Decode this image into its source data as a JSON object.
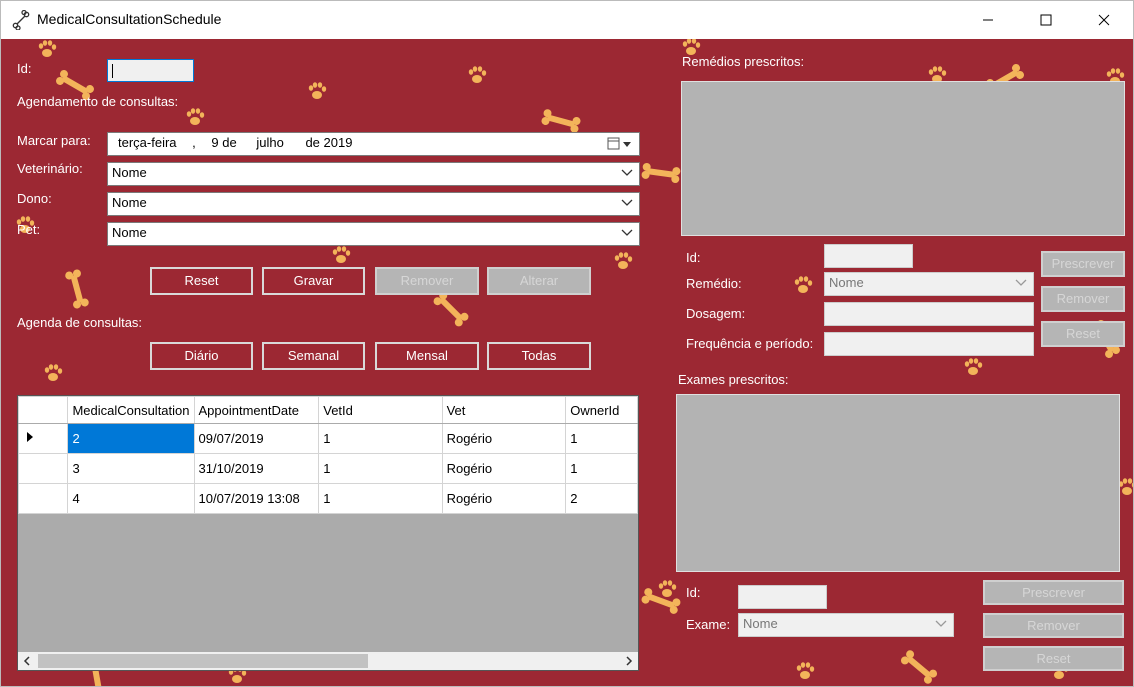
{
  "window": {
    "title": "MedicalConsultationSchedule"
  },
  "form": {
    "id_label": "Id:",
    "id_value": "",
    "agendamento_label": "Agendamento de consultas:",
    "marcar_label": "Marcar para:",
    "date": {
      "weekday": "terça-feira",
      "sep": ",",
      "day": "9 de",
      "month": "julho",
      "year": "de 2019"
    },
    "vet_label": "Veterinário:",
    "vet_value": "Nome",
    "dono_label": "Dono:",
    "dono_value": "Nome",
    "pet_label": "Pet:",
    "pet_value": "Nome",
    "buttons": {
      "reset": "Reset",
      "gravar": "Gravar",
      "remover": "Remover",
      "alterar": "Alterar"
    },
    "agenda_label": "Agenda de consultas:",
    "agenda_buttons": {
      "diario": "Diário",
      "semanal": "Semanal",
      "mensal": "Mensal",
      "todas": "Todas"
    }
  },
  "grid": {
    "columns": [
      "MedicalConsultation",
      "AppointmentDate",
      "VetId",
      "Vet",
      "OwnerId"
    ],
    "rows": [
      [
        "2",
        "09/07/2019",
        "1",
        "Rogério",
        "1"
      ],
      [
        "3",
        "31/10/2019",
        "1",
        "Rogério",
        "1"
      ],
      [
        "4",
        "10/07/2019 13:08",
        "1",
        "Rogério",
        "2"
      ]
    ]
  },
  "remedios": {
    "title": "Remédios prescritos:",
    "id_label": "Id:",
    "remedio_label": "Remédio:",
    "remedio_value": "Nome",
    "dosagem_label": "Dosagem:",
    "frequencia_label": "Frequência e período:",
    "buttons": {
      "prescrever": "Prescrever",
      "remover": "Remover",
      "reset": "Reset"
    }
  },
  "exames": {
    "title": "Exames prescritos:",
    "id_label": "Id:",
    "exame_label": "Exame:",
    "exame_value": "Nome",
    "buttons": {
      "prescrever": "Prescrever",
      "remover": "Remover",
      "reset": "Reset"
    }
  },
  "colors": {
    "background": "#9c2833",
    "bone": "#f3b45a",
    "selection": "#0078d7"
  }
}
